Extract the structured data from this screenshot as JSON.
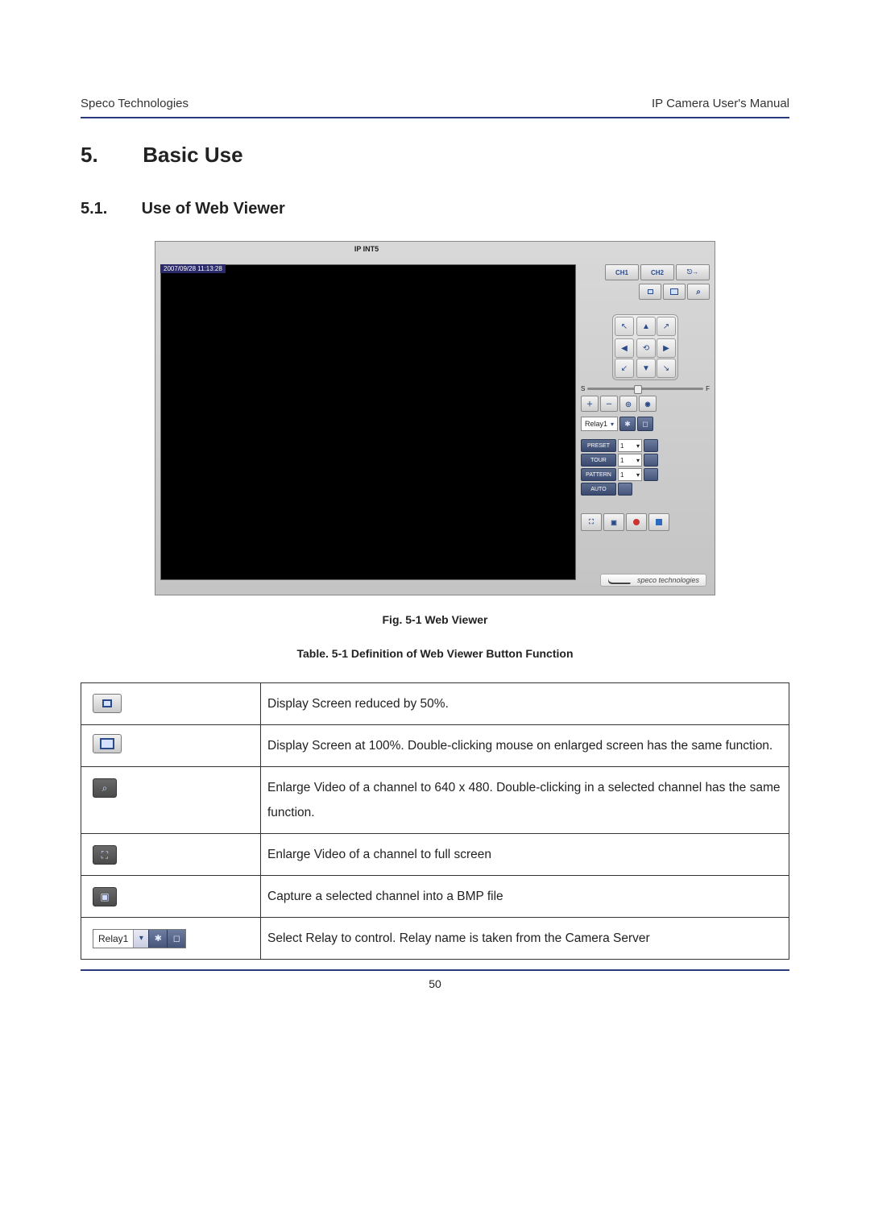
{
  "header": {
    "left": "Speco Technologies",
    "right": "IP Camera User's Manual"
  },
  "section": {
    "num": "5.",
    "title": "Basic Use"
  },
  "subsection": {
    "num": "5.1.",
    "title": "Use of Web Viewer"
  },
  "viewer": {
    "title": "IP INT5",
    "timestamp": "2007/09/28 11:13:28",
    "ch_labels": [
      "CH1",
      "CH2"
    ],
    "speed": {
      "s": "S",
      "f": "F"
    },
    "relay": {
      "selected": "Relay1"
    },
    "preset_rows": [
      {
        "label": "PRESET",
        "value": "1"
      },
      {
        "label": "TOUR",
        "value": "1"
      },
      {
        "label": "PATTERN",
        "value": "1"
      },
      {
        "label": "AUTO",
        "value": ""
      }
    ],
    "brand": "speco technologies"
  },
  "fig_caption": "Fig. 5-1 Web Viewer",
  "table_caption": "Table. 5-1 Definition of Web Viewer Button Function",
  "defs": [
    {
      "icon": "reduce-50",
      "text": "Display Screen reduced by 50%."
    },
    {
      "icon": "size-100",
      "text": "Display Screen at 100%. Double-clicking mouse on enlarged screen has the same function."
    },
    {
      "icon": "enlarge-640",
      "text": "Enlarge Video of a channel to 640 x 480. Double-clicking in a selected channel has the same function."
    },
    {
      "icon": "fullscreen",
      "text": "Enlarge Video of a channel to full screen"
    },
    {
      "icon": "capture",
      "text": "Capture a selected channel into a BMP file"
    },
    {
      "icon": "relay",
      "text": "Select Relay to control. Relay name is taken from the Camera Server"
    }
  ],
  "relay_chip_label": "Relay1",
  "page_number": "50"
}
